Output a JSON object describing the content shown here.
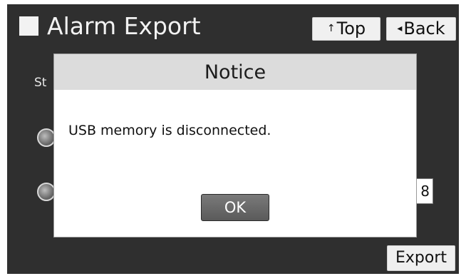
{
  "header": {
    "title": "Alarm Export",
    "top_button": {
      "arrow": "↑",
      "label": "Top"
    },
    "back_button": {
      "arrow": "◂",
      "label": "Back"
    }
  },
  "background": {
    "partial_label": "St",
    "number_field_value": "8",
    "export_label": "Export"
  },
  "dialog": {
    "title": "Notice",
    "message": "USB memory is disconnected.",
    "ok_label": "OK"
  }
}
